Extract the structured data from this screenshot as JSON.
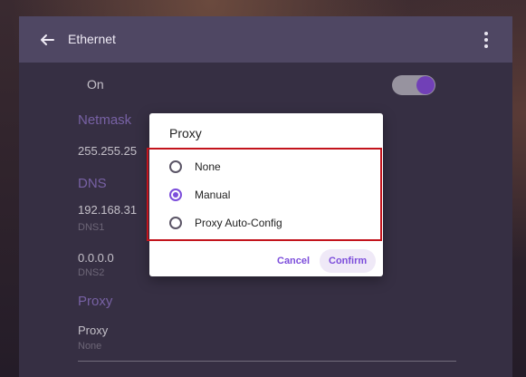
{
  "appbar": {
    "title": "Ethernet"
  },
  "toggle_row": {
    "label": "On",
    "state": "on"
  },
  "settings": {
    "netmask": {
      "header": "Netmask",
      "value": "255.255.25"
    },
    "dns": {
      "header": "DNS",
      "dns1_value": "192.168.31",
      "dns1_label": "DNS1",
      "dns2_value": "0.0.0.0",
      "dns2_label": "DNS2"
    },
    "proxy": {
      "header": "Proxy",
      "title": "Proxy",
      "value": "None"
    }
  },
  "dialog": {
    "title": "Proxy",
    "options": [
      {
        "label": "None",
        "selected": false
      },
      {
        "label": "Manual",
        "selected": true
      },
      {
        "label": "Proxy Auto-Config",
        "selected": false
      }
    ],
    "cancel_label": "Cancel",
    "confirm_label": "Confirm"
  },
  "colors": {
    "accent": "#7c4ddb",
    "panel": "#433a52",
    "highlight_box": "#c3141c"
  },
  "icons": {
    "back": "arrow-left-icon",
    "more": "more-vert-icon"
  }
}
